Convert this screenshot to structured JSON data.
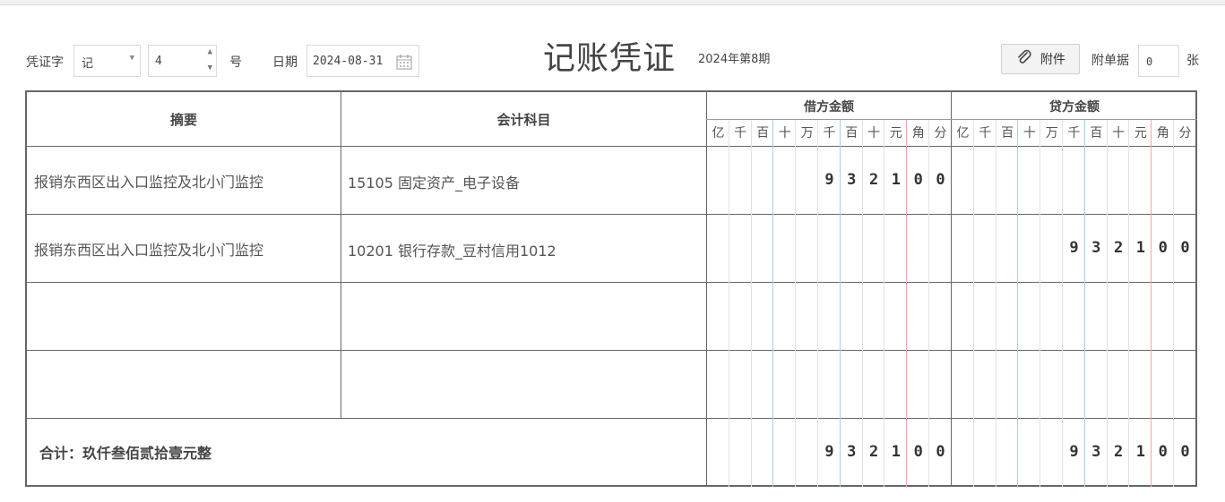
{
  "header": {
    "voucher_word_label": "凭证字",
    "voucher_word_value": "记",
    "voucher_number": "4",
    "number_suffix": "号",
    "date_label": "日期",
    "date_value": "2024-08-31",
    "title": "记账凭证",
    "period": "2024年第8期",
    "attach_button": "附件",
    "attach_count_label": "附单据",
    "attach_count_value": "0",
    "attach_count_unit": "张"
  },
  "table": {
    "summary_header": "摘要",
    "account_header": "会计科目",
    "debit_header": "借方金额",
    "credit_header": "贷方金额",
    "units": [
      "亿",
      "千",
      "百",
      "十",
      "万",
      "千",
      "百",
      "十",
      "元",
      "角",
      "分"
    ],
    "rows": [
      {
        "summary": "报销东西区出入口监控及北小门监控",
        "account": "15105 固定资产_电子设备",
        "debit": [
          "",
          "",
          "",
          "",
          "",
          "9",
          "3",
          "2",
          "1",
          "0",
          "0"
        ],
        "credit": [
          "",
          "",
          "",
          "",
          "",
          "",
          "",
          "",
          "",
          "",
          ""
        ]
      },
      {
        "summary": "报销东西区出入口监控及北小门监控",
        "account": "10201 银行存款_豆村信用1012",
        "debit": [
          "",
          "",
          "",
          "",
          "",
          "",
          "",
          "",
          "",
          "",
          ""
        ],
        "credit": [
          "",
          "",
          "",
          "",
          "",
          "9",
          "3",
          "2",
          "1",
          "0",
          "0"
        ]
      },
      {
        "summary": "",
        "account": "",
        "debit": [
          "",
          "",
          "",
          "",
          "",
          "",
          "",
          "",
          "",
          "",
          ""
        ],
        "credit": [
          "",
          "",
          "",
          "",
          "",
          "",
          "",
          "",
          "",
          "",
          ""
        ]
      },
      {
        "summary": "",
        "account": "",
        "debit": [
          "",
          "",
          "",
          "",
          "",
          "",
          "",
          "",
          "",
          "",
          ""
        ],
        "credit": [
          "",
          "",
          "",
          "",
          "",
          "",
          "",
          "",
          "",
          "",
          ""
        ]
      }
    ],
    "total_label": "合计：玖仟叁佰贰拾壹元整",
    "total_debit": [
      "",
      "",
      "",
      "",
      "",
      "9",
      "3",
      "2",
      "1",
      "0",
      "0"
    ],
    "total_credit": [
      "",
      "",
      "",
      "",
      "",
      "9",
      "3",
      "2",
      "1",
      "0",
      "0"
    ]
  },
  "colors": {
    "blue_sep": "#a9cdea",
    "red_sep": "#f2a7a7",
    "light_sep": "#e2e2e2"
  }
}
